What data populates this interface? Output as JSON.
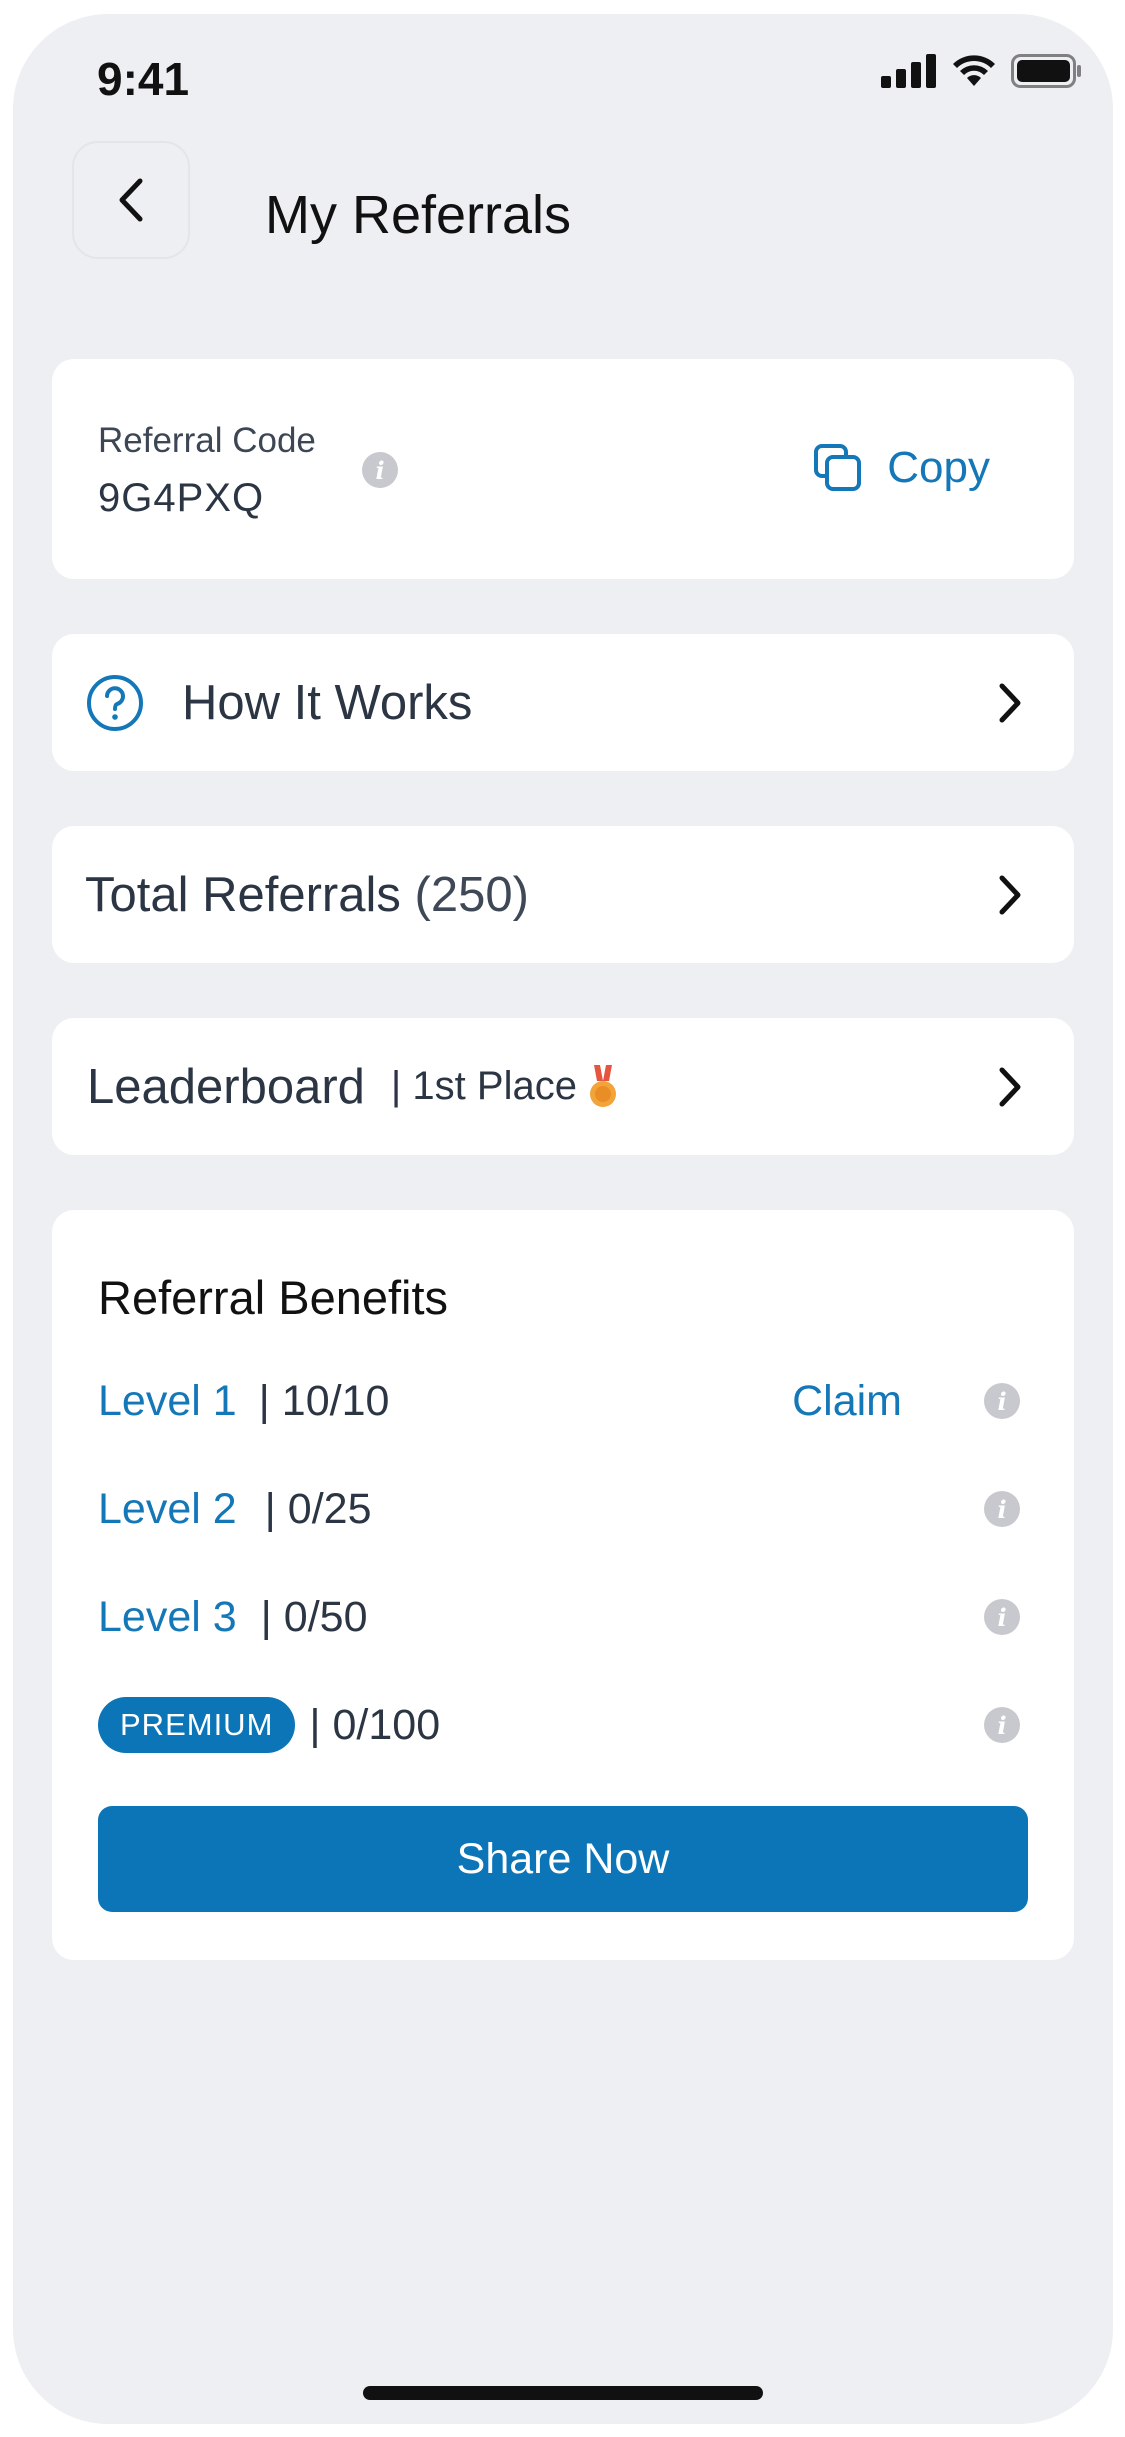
{
  "status": {
    "time": "9:41"
  },
  "header": {
    "title": "My Referrals"
  },
  "referral": {
    "label": "Referral Code",
    "code": "9G4PXQ",
    "copy_label": "Copy"
  },
  "how_it_works": {
    "label": "How It Works"
  },
  "total_referrals": {
    "label": "Total Referrals",
    "count": "(250)"
  },
  "leaderboard": {
    "label": "Leaderboard",
    "place": "| 1st Place"
  },
  "benefits": {
    "title": "Referral Benefits",
    "levels": [
      {
        "name": "Level 1",
        "progress": "| 10/10",
        "action": "Claim"
      },
      {
        "name": "Level 2",
        "progress": "| 0/25"
      },
      {
        "name": "Level 3",
        "progress": "| 0/50"
      },
      {
        "name": "PREMIUM",
        "progress": "| 0/100"
      }
    ],
    "share_label": "Share Now"
  },
  "colors": {
    "accent": "#0b75b8",
    "link": "#1477b8",
    "background": "#eeeff3"
  }
}
